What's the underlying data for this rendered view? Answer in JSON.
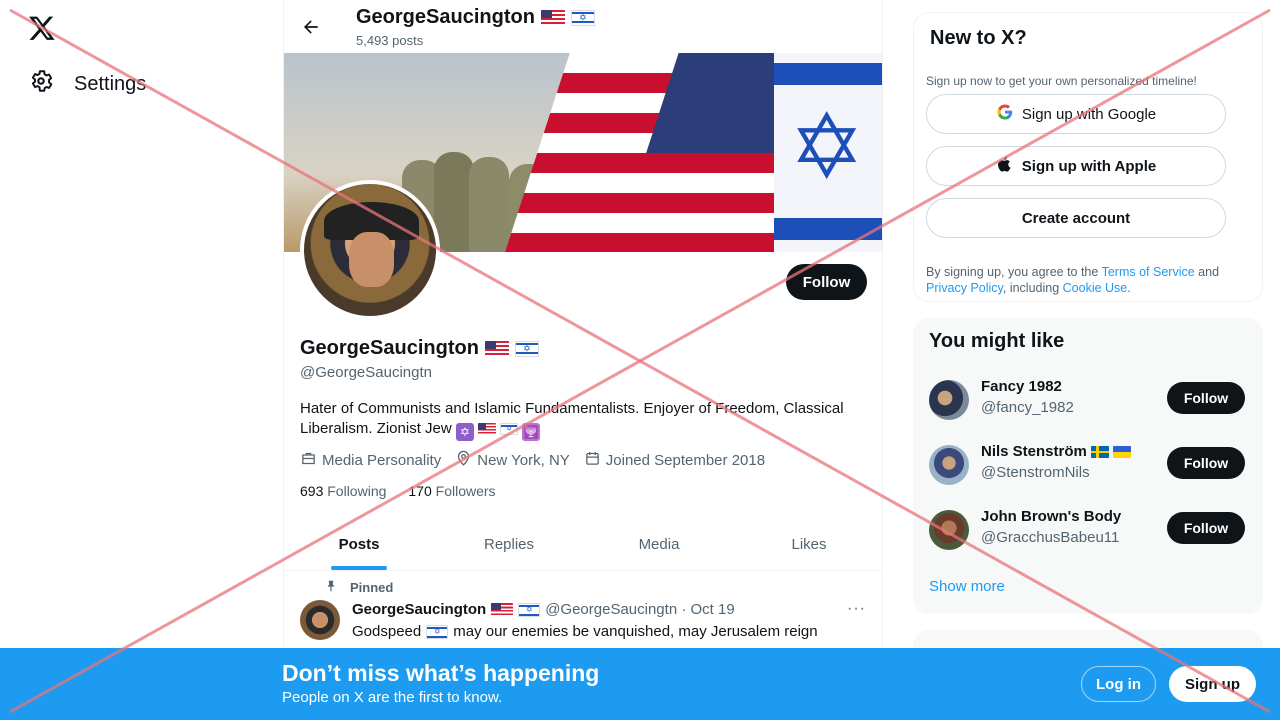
{
  "nav": {
    "logo_icon": "x-logo-icon",
    "settings_label": "Settings"
  },
  "header": {
    "name": "GeorgeSaucington",
    "posts_count": "5,493 posts"
  },
  "profile": {
    "name": "GeorgeSaucington",
    "handle": "@GeorgeSaucingtn",
    "bio": "Hater of Communists and Islamic Fundamentalists. Enjoyer of Freedom, Classical Liberalism. Zionist Jew",
    "category": "Media Personality",
    "location": "New York, NY",
    "joined": "Joined September 2018",
    "following_count": "693",
    "following_label": "Following",
    "followers_count": "170",
    "followers_label": "Followers",
    "follow_label": "Follow"
  },
  "tabs": [
    "Posts",
    "Replies",
    "Media",
    "Likes"
  ],
  "pinned_post": {
    "pinned_label": "Pinned",
    "name": "GeorgeSaucington",
    "handle_date": "@GeorgeSaucingtn · Oct 19",
    "text_before": "Godspeed",
    "text_after": "may our enemies be vanquished, may Jerusalem reign",
    "more": "···"
  },
  "new_to_x": {
    "title": "New to X?",
    "subtitle": "Sign up now to get your own personalized timeline!",
    "google_label": "Sign up with Google",
    "apple_label": "Sign up with Apple",
    "create_label": "Create account",
    "terms_prefix": "By signing up, you agree to the ",
    "terms_link": "Terms of Service",
    "terms_and": " and ",
    "privacy_link": "Privacy Policy",
    "terms_including": ", including ",
    "cookie_link": "Cookie Use",
    "terms_end": "."
  },
  "you_might_like": {
    "title": "You might like",
    "suggestions": [
      {
        "name": "Fancy 1982",
        "handle": "@fancy_1982",
        "follow": "Follow"
      },
      {
        "name": "Nils Stenström",
        "handle": "@StenstromNils",
        "follow": "Follow"
      },
      {
        "name": "John Brown's Body",
        "handle": "@GracchusBabeu11",
        "follow": "Follow"
      }
    ],
    "show_more": "Show more"
  },
  "bottom_bar": {
    "title": "Don’t miss what’s happening",
    "subtitle": "People on X are the first to know.",
    "login_label": "Log in",
    "signup_label": "Sign up"
  },
  "colors": {
    "accent": "#1d9bf0",
    "text_primary": "#0f1419",
    "text_secondary": "#536471",
    "overlay_x": "#e8747a"
  }
}
